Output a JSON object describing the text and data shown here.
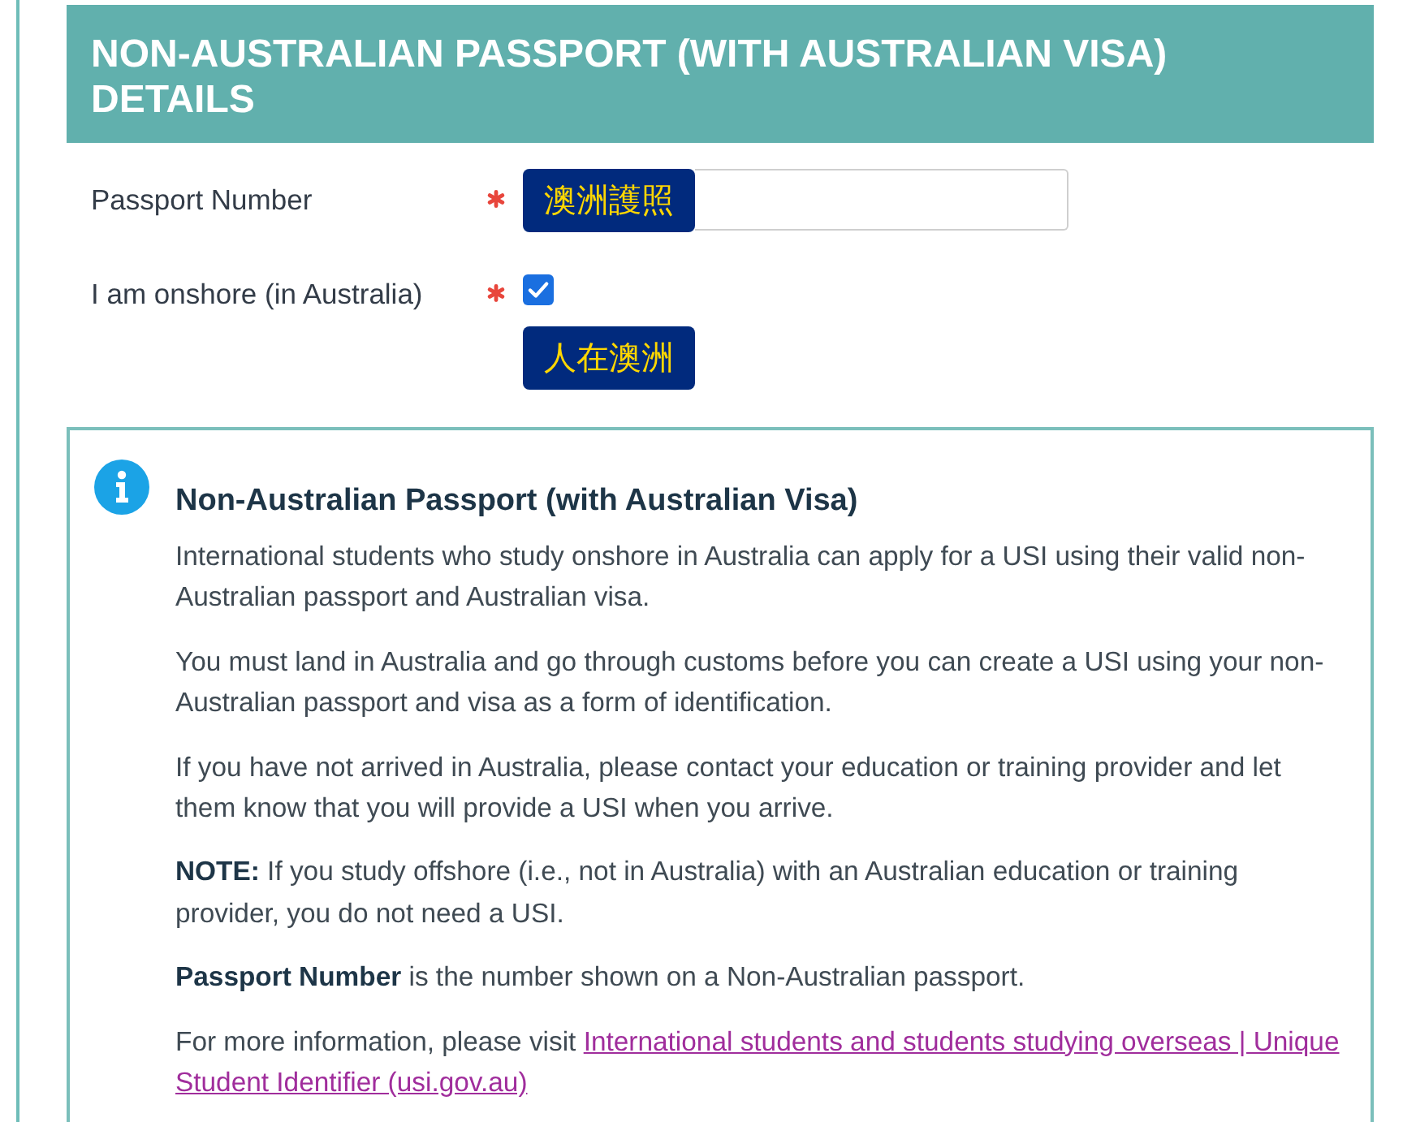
{
  "section": {
    "title": "NON-AUSTRALIAN PASSPORT (WITH AUSTRALIAN VISA) DETAILS"
  },
  "fields": [
    {
      "kind": "text",
      "label": "Passport Number",
      "required": true,
      "annotation": "澳洲護照"
    },
    {
      "kind": "checkbox",
      "label": "I am onshore (in Australia)",
      "required": true,
      "checked": true,
      "annotation": "人在澳洲"
    }
  ],
  "info": {
    "title": "Non-Australian Passport (with Australian Visa)",
    "paragraphs": [
      {
        "lines": [
          "International students who study onshore in Australia can apply for a USI using their valid non-",
          "Australian passport and Australian visa."
        ]
      },
      {
        "lines": [
          "You must land in Australia and go through customs before you can create a USI using your non-",
          "Australian passport and visa as a form of identification."
        ]
      },
      {
        "lines": [
          "If you have not arrived in Australia, please contact your education or training provider and let",
          "them know that you will provide a USI when you arrive."
        ]
      },
      {
        "lines": [
          "**NOTE:** If you study offshore (i.e., not in Australia) with an Australian education or training",
          "provider, you do not need a USI."
        ]
      },
      {
        "lines": [
          "**Passport Number** is the number shown on a Non-Australian passport."
        ]
      },
      {
        "lines": [
          "For more information, please visit"
        ],
        "link_lines": [
          "International students and students studying overseas | Unique",
          "Student Identifier (usi.gov.au)"
        ]
      }
    ]
  }
}
